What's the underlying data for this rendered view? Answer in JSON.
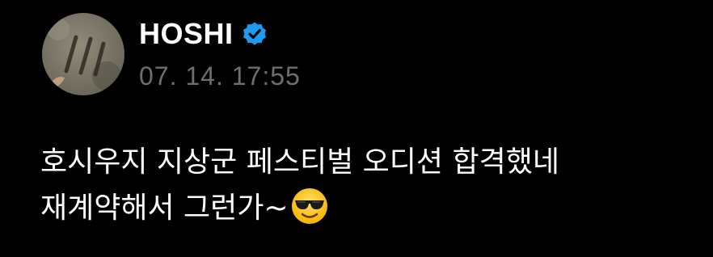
{
  "post": {
    "author_name": "HOSHI",
    "verified": true,
    "timestamp": "07. 14. 17:55",
    "text_line_1": "호시우지 지상군 페스티벌 오디션 합격했네",
    "text_line_2": "재계약해서 그런가~",
    "emoji": "smiling-face-with-sunglasses"
  },
  "colors": {
    "background": "#000000",
    "text": "#ffffff",
    "timestamp": "#6e6e6e",
    "verified_badge": "#1d9bf0"
  }
}
